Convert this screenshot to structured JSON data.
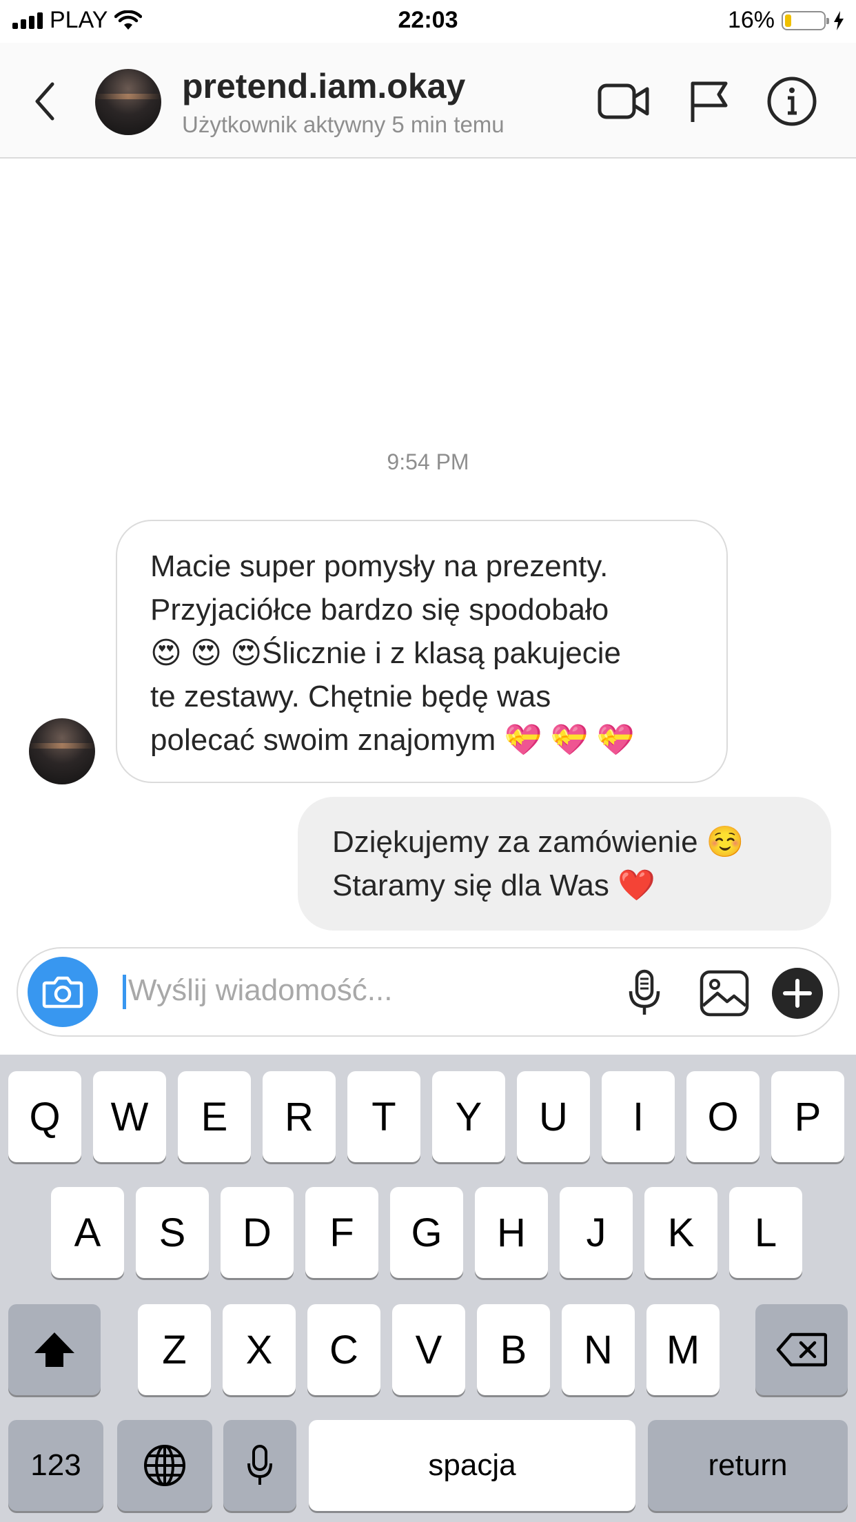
{
  "status_bar": {
    "carrier": "PLAY",
    "time": "22:03",
    "battery": "16%",
    "battery_level": 0.16
  },
  "header": {
    "username": "pretend.iam.okay",
    "activity": "Użytkownik aktywny 5 min temu"
  },
  "conversation": {
    "timestamp": "9:54 PM",
    "incoming": {
      "lines": [
        "Macie super pomysły na prezenty.",
        "Przyjaciółce bardzo się spodobało",
        "😍 😍 😍Ślicznie i z klasą pakujecie",
        "te zestawy. Chętnie będę was",
        "polecać swoim znajomym 💝 💝 💝"
      ]
    },
    "outgoing": {
      "lines": [
        "Dziękujemy za zamówienie ☺️",
        "Staramy się dla Was ❤️"
      ]
    }
  },
  "composer": {
    "placeholder": "Wyślij wiadomość..."
  },
  "keyboard": {
    "row1": [
      "Q",
      "W",
      "E",
      "R",
      "T",
      "Y",
      "U",
      "I",
      "O",
      "P"
    ],
    "row2": [
      "A",
      "S",
      "D",
      "F",
      "G",
      "H",
      "J",
      "K",
      "L"
    ],
    "row3": [
      "Z",
      "X",
      "C",
      "V",
      "B",
      "N",
      "M"
    ],
    "numbers": "123",
    "space": "spacja",
    "return": "return"
  },
  "colors": {
    "accent": "#3897f0",
    "bubble_out": "#efefef",
    "keyboard_bg": "#d1d3d9",
    "battery_fill": "#f0c000"
  }
}
